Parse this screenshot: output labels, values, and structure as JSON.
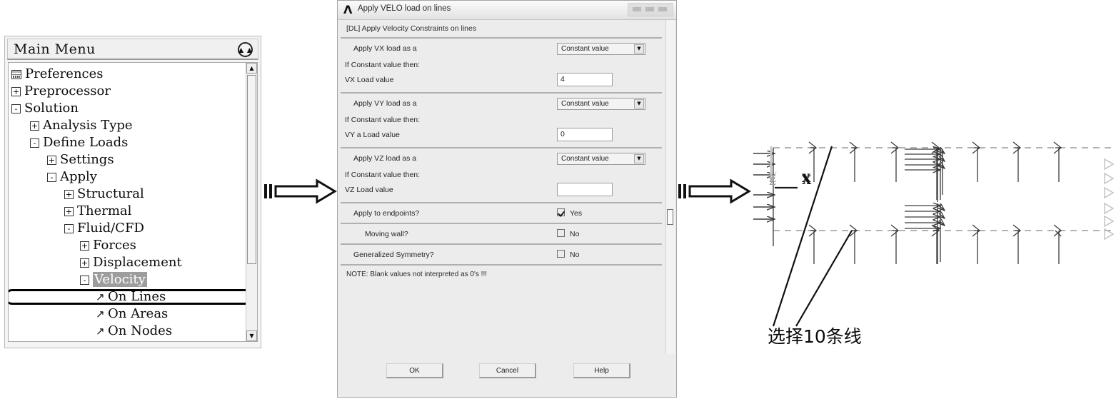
{
  "main_menu": {
    "title": "Main Menu",
    "collapse_icon": "double-chevron-up-icon",
    "items": [
      {
        "label": "Preferences",
        "indent": 0,
        "toggle": "",
        "icon": "preferences-icon"
      },
      {
        "label": "Preprocessor",
        "indent": 0,
        "toggle": "+",
        "icon": ""
      },
      {
        "label": "Solution",
        "indent": 0,
        "toggle": "-",
        "icon": ""
      },
      {
        "label": "Analysis Type",
        "indent": 1,
        "toggle": "+",
        "icon": ""
      },
      {
        "label": "Define Loads",
        "indent": 1,
        "toggle": "-",
        "icon": ""
      },
      {
        "label": "Settings",
        "indent": 2,
        "toggle": "+",
        "icon": ""
      },
      {
        "label": "Apply",
        "indent": 2,
        "toggle": "-",
        "icon": ""
      },
      {
        "label": "Structural",
        "indent": 3,
        "toggle": "+",
        "icon": ""
      },
      {
        "label": "Thermal",
        "indent": 3,
        "toggle": "+",
        "icon": ""
      },
      {
        "label": "Fluid/CFD",
        "indent": 3,
        "toggle": "-",
        "icon": ""
      },
      {
        "label": "Forces",
        "indent": 4,
        "toggle": "+",
        "icon": ""
      },
      {
        "label": "Displacement",
        "indent": 4,
        "toggle": "+",
        "icon": ""
      },
      {
        "label": "Velocity",
        "indent": 4,
        "toggle": "-",
        "icon": "",
        "highlight": true
      },
      {
        "label": "On Lines",
        "indent": 5,
        "toggle": "",
        "icon": "pick-arrow-icon",
        "selected": true
      },
      {
        "label": "On Areas",
        "indent": 5,
        "toggle": "",
        "icon": "pick-arrow-icon"
      },
      {
        "label": "On Nodes",
        "indent": 5,
        "toggle": "",
        "icon": "pick-arrow-icon"
      }
    ],
    "scroll_up": "▲",
    "scroll_down": "▼"
  },
  "dialog": {
    "title": "Apply VELO load on lines",
    "subtitle": "[DL] Apply Velocity Constraints on lines",
    "groups": [
      {
        "apply_label": "Apply VX load as a",
        "combo_value": "Constant value",
        "if_label": "If Constant value then:",
        "value_label": "VX  Load value",
        "value": "4"
      },
      {
        "apply_label": "Apply VY load as a",
        "combo_value": "Constant value",
        "if_label": "If Constant value then:",
        "value_label": "VY a Load value",
        "value": "0"
      },
      {
        "apply_label": "Apply VZ load as a",
        "combo_value": "Constant value",
        "if_label": "If Constant value then:",
        "value_label": "VZ  Load value",
        "value": ""
      }
    ],
    "checks": [
      {
        "label": "Apply to endpoints?",
        "state": "Yes",
        "checked": true
      },
      {
        "label": "Moving wall?",
        "state": "No",
        "checked": false
      },
      {
        "label": "Generalized Symmetry?",
        "state": "No",
        "checked": false
      }
    ],
    "note": "NOTE: Blank values not interpreted as 0's !!!",
    "buttons": {
      "ok": "OK",
      "cancel": "Cancel",
      "help": "Help"
    }
  },
  "model": {
    "axis_z": "Z",
    "axis_x": "X",
    "caption": "选择10条线"
  },
  "colors": {
    "highlight_bg": "#9d9d9d",
    "selection_outline": "#000000",
    "dialog_bg": "#ececec",
    "arrow_outline": "#111111",
    "model_line": "#3a3a3a",
    "model_dash": "#9a9a9a"
  }
}
